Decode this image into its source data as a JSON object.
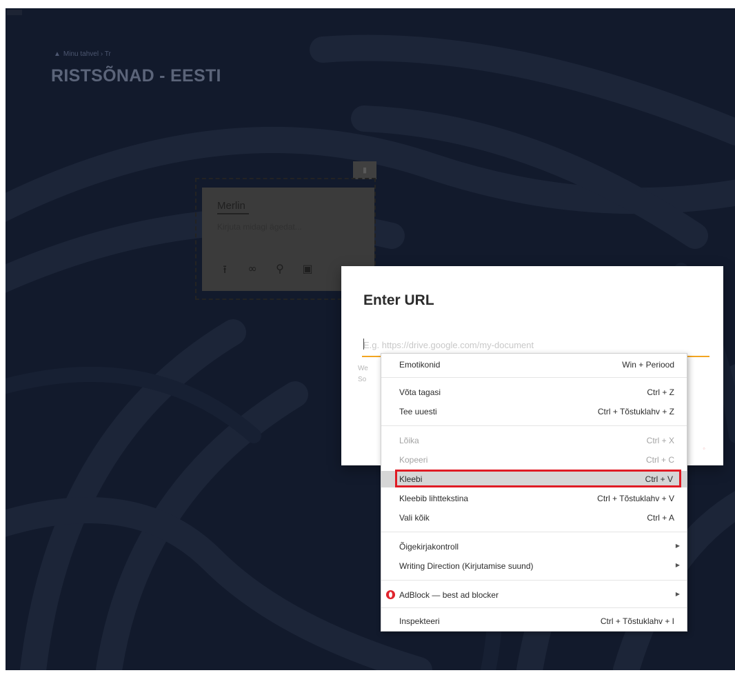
{
  "board": {
    "breadcrumb": "Minu tahvel › Tr",
    "title": "RISTSÕNAD - EESTI"
  },
  "card": {
    "author": "Merlin",
    "body_placeholder": "Kirjuta midagi ägedat..."
  },
  "dialog": {
    "title": "Enter URL",
    "url_placeholder": "E.g. https://drive.google.com/my-document",
    "hint_line1": "We",
    "hint_line2": "So"
  },
  "context_menu": {
    "items": [
      {
        "label": "Emotikonid",
        "shortcut": "Win + Periood",
        "disabled": false
      },
      {
        "label": "Võta tagasi",
        "shortcut": "Ctrl + Z",
        "disabled": false
      },
      {
        "label": "Tee uuesti",
        "shortcut": "Ctrl + Tõstuklahv + Z",
        "disabled": false
      },
      {
        "label": "Lõika",
        "shortcut": "Ctrl + X",
        "disabled": true
      },
      {
        "label": "Kopeeri",
        "shortcut": "Ctrl + C",
        "disabled": true
      },
      {
        "label": "Kleebi",
        "shortcut": "Ctrl + V",
        "disabled": false,
        "highlighted": true
      },
      {
        "label": "Kleebib lihttekstina",
        "shortcut": "Ctrl + Tõstuklahv + V",
        "disabled": false
      },
      {
        "label": "Vali kõik",
        "shortcut": "Ctrl + A",
        "disabled": false
      },
      {
        "label": "Õigekirjakontroll",
        "submenu": true
      },
      {
        "label": "Writing Direction (Kirjutamise suund)",
        "submenu": true
      },
      {
        "label": "AdBlock — best ad blocker",
        "submenu": true,
        "icon": "opera-icon"
      },
      {
        "label": "Inspekteeri",
        "shortcut": "Ctrl + Tõstuklahv + I",
        "disabled": false
      }
    ]
  },
  "colors": {
    "backdrop": "#121a2c",
    "accent_underline": "#f3a521",
    "highlight_outline": "#e01b24",
    "highlight_row": "#d6d6d6"
  }
}
